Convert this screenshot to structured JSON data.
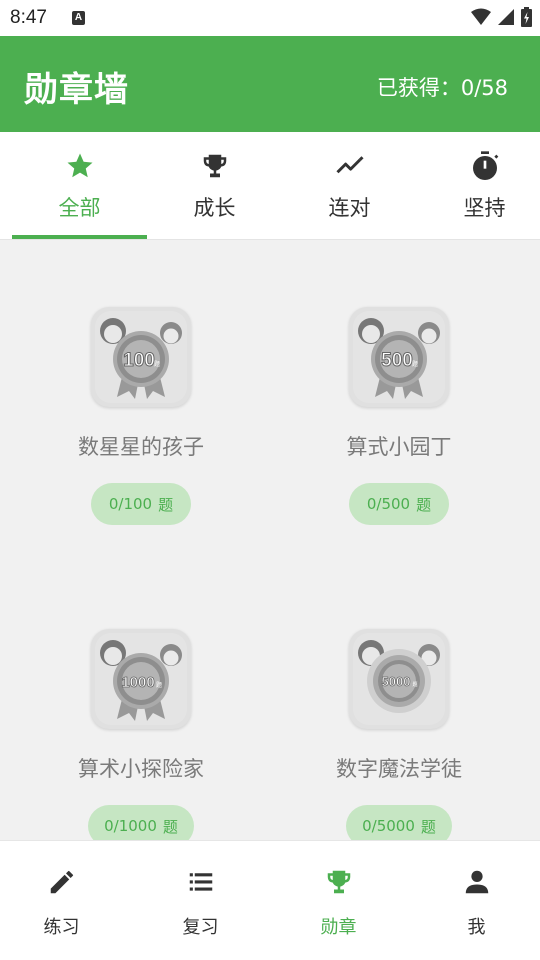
{
  "status_bar": {
    "time": "8:47",
    "notification_letter": "A"
  },
  "header": {
    "title": "勋章墙",
    "earned": "已获得：0/58"
  },
  "tabs": [
    {
      "label": "全部",
      "icon": "star-icon",
      "active": true
    },
    {
      "label": "成长",
      "icon": "trophy-icon",
      "active": false
    },
    {
      "label": "连对",
      "icon": "trending-icon",
      "active": false
    },
    {
      "label": "坚持",
      "icon": "timer-icon",
      "active": false
    }
  ],
  "badges": [
    {
      "number": "100",
      "suffix": "题",
      "name": "数星星的孩子",
      "progress": "0/100",
      "unit": "题"
    },
    {
      "number": "500",
      "suffix": "题",
      "name": "算式小园丁",
      "progress": "0/500",
      "unit": "题"
    },
    {
      "number": "1000",
      "suffix": "题",
      "name": "算术小探险家",
      "progress": "0/1000",
      "unit": "题"
    },
    {
      "number": "5000",
      "suffix": "题",
      "name": "数字魔法学徒",
      "progress": "0/5000",
      "unit": "题"
    }
  ],
  "bottom_nav": [
    {
      "label": "练习",
      "icon": "pencil-icon",
      "active": false
    },
    {
      "label": "复习",
      "icon": "list-icon",
      "active": false
    },
    {
      "label": "勋章",
      "icon": "trophy-icon",
      "active": true
    },
    {
      "label": "我",
      "icon": "person-icon",
      "active": false
    }
  ],
  "colors": {
    "primary": "#4caf50",
    "progress_pill": "#c6e6c3",
    "inactive_icon": "#333333"
  }
}
